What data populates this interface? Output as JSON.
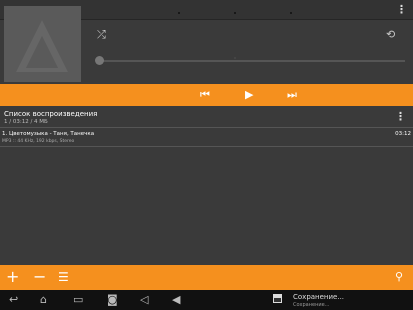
{
  "player": {
    "shuffle_icon": "shuffle-icon",
    "repeat_icon": "repeat-icon",
    "seek_progress": 0
  },
  "transport": {
    "prev_icon": "skip-previous-icon",
    "play_icon": "play-icon",
    "next_icon": "skip-next-icon"
  },
  "playlist": {
    "title": "Список воспроизведения",
    "summary": "1 / 03:12 / 4 МБ",
    "tracks": [
      {
        "title": "1. Цветомузыка - Таня, Танечка",
        "info": "MP3 :: 44 KHz, 192 kbps, Stereo",
        "duration": "03:12"
      }
    ]
  },
  "bottombar": {
    "add_icon": "plus-icon",
    "remove_icon": "minus-icon",
    "sort_icon": "sort-icon",
    "search_icon": "search-icon"
  },
  "notification": {
    "title": "Сохранение...",
    "subtitle": "Сохранение..."
  },
  "colors": {
    "accent": "#f5901e",
    "background": "#3a3a3a"
  }
}
